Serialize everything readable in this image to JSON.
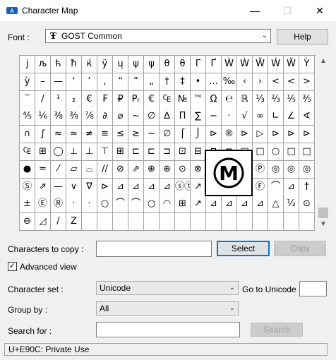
{
  "window": {
    "title": "Character Map",
    "minimize": "—",
    "maximize": "☐",
    "close": "✕"
  },
  "font": {
    "label": "Font :",
    "value": "GOST Common",
    "icon_glyph": "Ŧ",
    "help_label": "Help"
  },
  "grid_rows": [
    [
      "j",
      "љ",
      "ћ",
      "ħ",
      "ќ",
      "ÿ",
      "ų",
      "ψ",
      "ψ",
      "θ",
      "θ",
      "Γ",
      "Ґ",
      "Ẁ",
      "Ẁ",
      "Ẅ",
      "Ẃ",
      "Ẅ",
      "Ỳ"
    ],
    [
      "ỳ",
      "–",
      "—",
      "‘",
      "’",
      "‚",
      "“",
      "”",
      "„",
      "†",
      "‡",
      "•",
      "…",
      "‰",
      "‹",
      "›",
      "<",
      "<",
      ">"
    ],
    [
      "‾",
      "/",
      "¹",
      "₂",
      "€",
      "₣",
      "₽",
      "Pₜ",
      "€",
      "₠",
      "№",
      "™",
      "Ω",
      "℮",
      "ℝ",
      "⅓",
      "⅔",
      "⅕",
      "⅗"
    ],
    [
      "⅘",
      "⅙",
      "⅜",
      "⅜",
      "⅞",
      "∂",
      "⌀",
      "∼",
      "∅",
      "∆",
      "Π",
      "∑",
      "−",
      "·",
      "√",
      "∞",
      "∟",
      "∠",
      "∢"
    ],
    [
      "∩",
      "∫",
      "≈",
      "≃",
      "≠",
      "≡",
      "≤",
      "≥",
      "~",
      "∅",
      "⌠",
      "⌡",
      "⊳",
      "®",
      "⊳",
      "▷",
      "⊳",
      "⊳",
      "⊳"
    ],
    [
      "₠",
      "⊞",
      "◯",
      "⊥",
      "⊥",
      "⊤",
      "⊞",
      "⊏",
      "⊏",
      "⊐",
      "⊡",
      "⊟",
      "⊓",
      "⊏",
      "□",
      "□",
      "○",
      "□",
      "□"
    ],
    [
      "●",
      "═",
      "⁄",
      "▱",
      "⌓",
      "//",
      "⊘",
      "⇗",
      "⊕",
      "⊕",
      "⊙",
      "⊗",
      "⊙",
      "Ⓜ",
      "□",
      "Ⓟ",
      "◎",
      "◎",
      "◎"
    ],
    [
      "Ⓢ",
      "⇗",
      "—",
      "∨",
      "∇",
      "⊳",
      "⊿",
      "⊿",
      "⊿",
      "⊿",
      "ⓢⓣ",
      "↗",
      "⊞",
      "⊞",
      "⊞",
      "Ⓕ",
      "⌒",
      "⊿",
      "†"
    ],
    [
      "±",
      "Ⓔ",
      "Ⓡ",
      "·",
      "·",
      "○",
      "⌒",
      "⌒",
      "○",
      "◠",
      "⊞",
      "↗",
      "⊿",
      "⊿",
      "⊿",
      "⊿",
      "△",
      "⅟₂",
      "⊙"
    ],
    [
      "⊖",
      "◿",
      "/",
      "Z",
      "",
      "",
      "",
      "",
      "",
      "",
      "",
      "",
      "",
      "",
      "",
      "",
      "",
      "",
      ""
    ]
  ],
  "zoom_char": "Ⓜ",
  "scroll": {
    "up": "▲",
    "down": "▼"
  },
  "copy": {
    "label": "Characters to copy :",
    "value": "",
    "select_label": "Select",
    "copy_label": "Copy"
  },
  "advanced": {
    "label": "Advanced view",
    "checked": "✓"
  },
  "charset": {
    "label": "Character set :",
    "value": "Unicode"
  },
  "goto_unicode": {
    "label": "Go to Unicode :",
    "value": ""
  },
  "group_by": {
    "label": "Group by :",
    "value": "All"
  },
  "search": {
    "label": "Search for :",
    "value": "",
    "button_label": "Search"
  },
  "status_bar": {
    "text": "U+E90C: Private Use"
  }
}
